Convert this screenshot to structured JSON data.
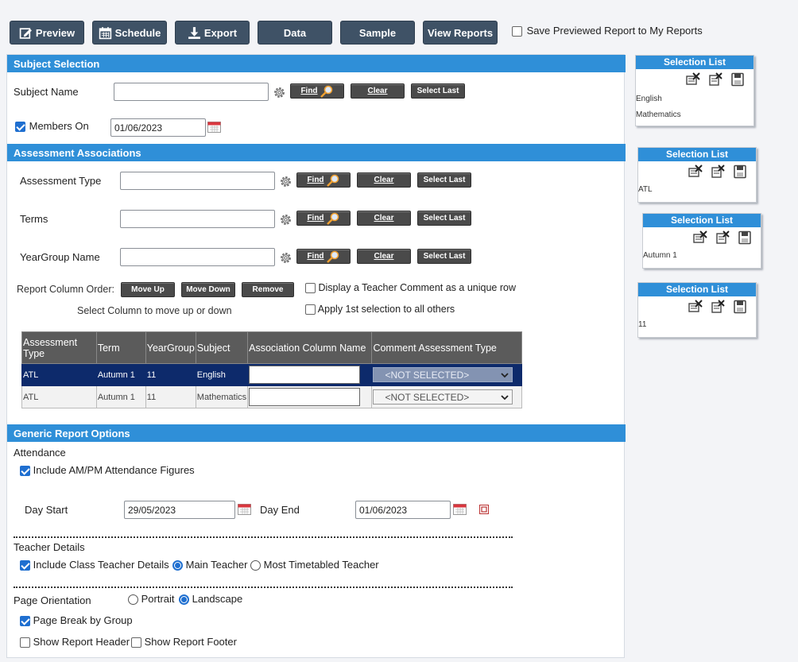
{
  "toolbar": {
    "preview": "Preview",
    "schedule": "Schedule",
    "export": "Export",
    "data": "Data",
    "sample": "Sample",
    "view_reports": "View Reports",
    "save_previewed_label": "Save Previewed Report to My Reports",
    "save_previewed_checked": false
  },
  "subject_selection": {
    "heading": "Subject Selection",
    "subject_name_label": "Subject Name",
    "subject_name_value": "",
    "members_on_label": "Members On",
    "members_on_checked": true,
    "members_on_value": "01/06/2023"
  },
  "buttons": {
    "find": "Find",
    "clear": "Clear",
    "select_last": "Select Last"
  },
  "assessment": {
    "heading": "Assessment Associations",
    "assessment_type_label": "Assessment Type",
    "terms_label": "Terms",
    "yeargroup_label": "YearGroup Name",
    "column_order_label": "Report Column Order:",
    "move_up": "Move Up",
    "move_down": "Move Down",
    "remove": "Remove",
    "select_column_hint": "Select Column to move up or down",
    "teacher_comment_label": "Display a Teacher Comment as a unique row",
    "apply_first_label": "Apply 1st selection to all others"
  },
  "table": {
    "headers": [
      "Assessment Type",
      "Term",
      "YearGroup",
      "Subject",
      "Association Column Name",
      "Comment Assessment Type"
    ],
    "rows": [
      {
        "type": "ATL",
        "term": "Autumn 1",
        "year": "11",
        "subject": "English",
        "assoc": "",
        "comment": "<NOT SELECTED>"
      },
      {
        "type": "ATL",
        "term": "Autumn 1",
        "year": "11",
        "subject": "Mathematics",
        "assoc": "",
        "comment": "<NOT SELECTED>"
      }
    ]
  },
  "generic": {
    "heading": "Generic Report Options",
    "attendance_label": "Attendance",
    "include_ampm_label": "Include AM/PM Attendance Figures",
    "day_start_label": "Day Start",
    "day_start_value": "29/05/2023",
    "day_end_label": "Day End",
    "day_end_value": "01/06/2023",
    "teacher_details_label": "Teacher Details",
    "include_class_teacher_label": "Include Class Teacher Details",
    "main_teacher_label": "Main Teacher",
    "most_timetabled_label": "Most Timetabled Teacher",
    "page_orientation_label": "Page Orientation",
    "portrait_label": "Portrait",
    "landscape_label": "Landscape",
    "page_break_label": "Page Break by Group",
    "show_header_label": "Show Report Header",
    "show_footer_label": "Show Report Footer"
  },
  "selection_lists": [
    {
      "title": "Selection List",
      "items": [
        "English",
        "Mathematics"
      ]
    },
    {
      "title": "Selection List",
      "items": [
        "ATL"
      ]
    },
    {
      "title": "Selection List",
      "items": [
        "Autumn 1"
      ]
    },
    {
      "title": "Selection List",
      "items": [
        "11"
      ]
    }
  ],
  "colors": {
    "toolbar_button": "#3f5266",
    "section_header": "#2f8fd8",
    "selected_row": "#0d2a6b",
    "checkbox_accent": "#1f6fd0"
  }
}
